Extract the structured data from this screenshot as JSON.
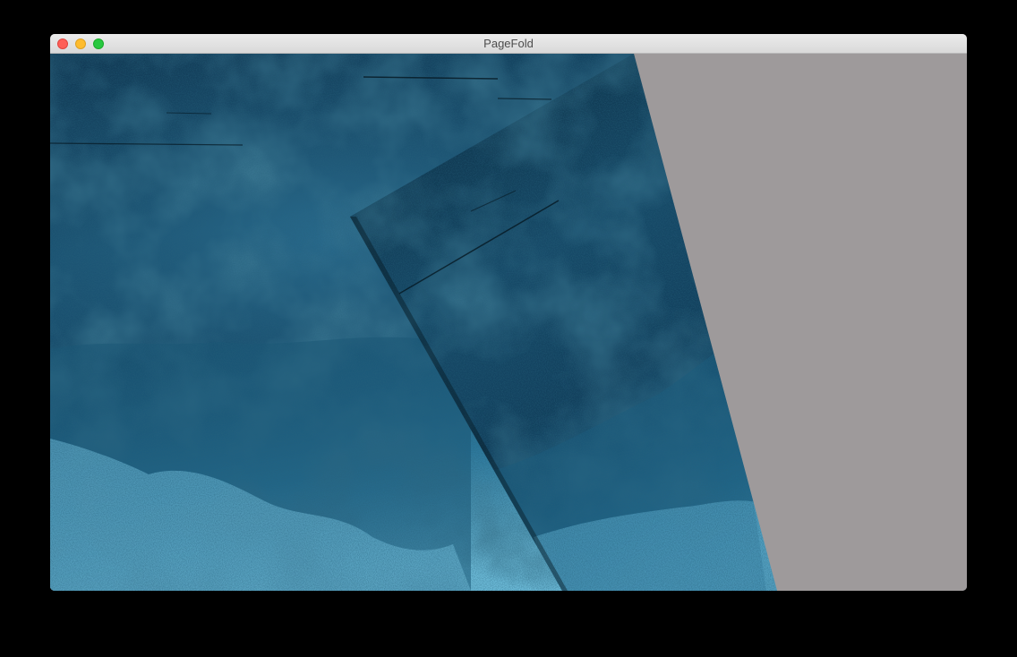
{
  "window": {
    "title": "PageFold"
  },
  "window_controls": {
    "close": "close-icon",
    "minimize": "minimize-icon",
    "zoom": "zoom-icon"
  },
  "colors": {
    "backdrop": "#000000",
    "canvas_background": "#9e9a9b",
    "texture_dark": "#0b2c42",
    "texture_mid": "#1d5f82",
    "texture_light": "#5fb0d0"
  }
}
